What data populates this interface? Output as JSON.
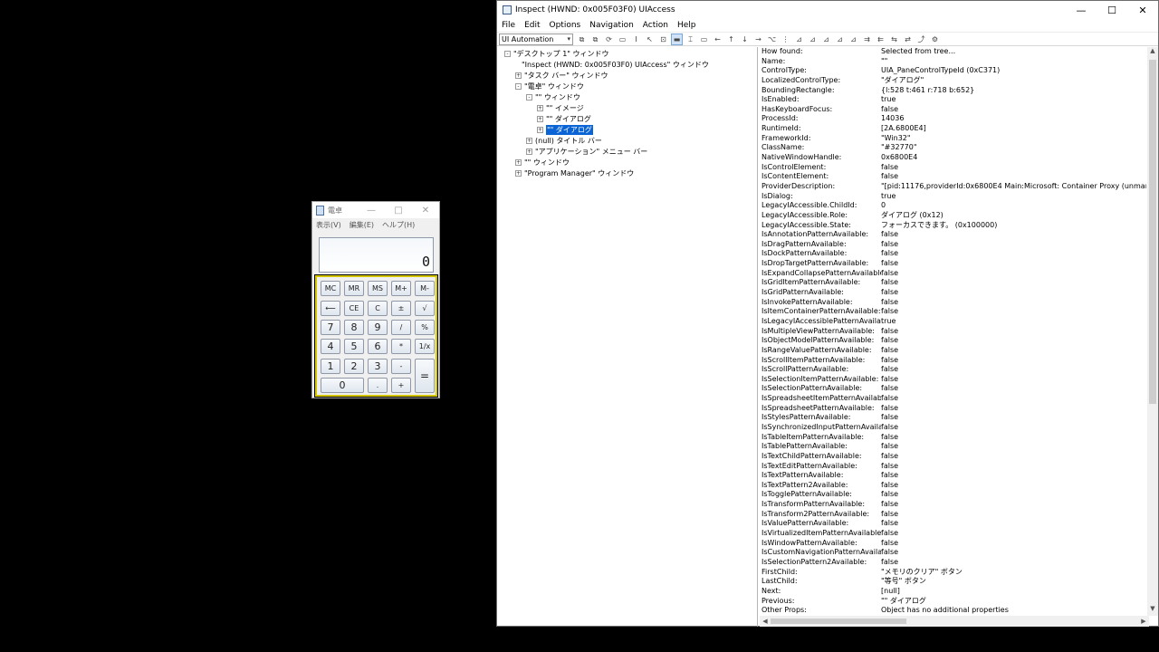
{
  "calculator": {
    "title": "電卓",
    "menu": [
      "表示(V)",
      "編集(E)",
      "ヘルプ(H)"
    ],
    "display": "0",
    "window_buttons": [
      "—",
      "□",
      "✕"
    ],
    "keys": [
      {
        "label": "MC",
        "name": "mc-key"
      },
      {
        "label": "MR",
        "name": "mr-key"
      },
      {
        "label": "MS",
        "name": "ms-key"
      },
      {
        "label": "M+",
        "name": "m-plus-key"
      },
      {
        "label": "M-",
        "name": "m-minus-key"
      },
      {
        "label": "⟵",
        "name": "backspace-key"
      },
      {
        "label": "CE",
        "name": "ce-key"
      },
      {
        "label": "C",
        "name": "c-key"
      },
      {
        "label": "±",
        "name": "plus-minus-key"
      },
      {
        "label": "√",
        "name": "sqrt-key"
      },
      {
        "label": "7",
        "name": "digit-7-key"
      },
      {
        "label": "8",
        "name": "digit-8-key"
      },
      {
        "label": "9",
        "name": "digit-9-key"
      },
      {
        "label": "/",
        "name": "divide-key"
      },
      {
        "label": "%",
        "name": "percent-key"
      },
      {
        "label": "4",
        "name": "digit-4-key"
      },
      {
        "label": "5",
        "name": "digit-5-key"
      },
      {
        "label": "6",
        "name": "digit-6-key"
      },
      {
        "label": "*",
        "name": "multiply-key"
      },
      {
        "label": "1/x",
        "name": "reciprocal-key"
      },
      {
        "label": "1",
        "name": "digit-1-key"
      },
      {
        "label": "2",
        "name": "digit-2-key"
      },
      {
        "label": "3",
        "name": "digit-3-key"
      },
      {
        "label": "-",
        "name": "minus-key"
      },
      {
        "label": "=",
        "name": "equals-key"
      },
      {
        "label": "0",
        "name": "digit-0-key"
      },
      {
        "label": ".",
        "name": "decimal-key"
      },
      {
        "label": "+",
        "name": "plus-key"
      }
    ]
  },
  "inspect": {
    "title": "Inspect  (HWND: 0x005F03F0) UIAccess",
    "window_buttons": [
      "—",
      "☐",
      "✕"
    ],
    "menu": [
      "File",
      "Edit",
      "Options",
      "Navigation",
      "Action",
      "Help"
    ],
    "mode": "UI Automation",
    "tree": [
      {
        "text": "\"デスクトップ 1\" ウィンドウ",
        "state": "-"
      },
      {
        "text": "\"Inspect  (HWND: 0x005F03F0) UIAccess\" ウィンドウ",
        "state": ""
      },
      {
        "text": "\"タスク バー\" ウィンドウ",
        "state": "+"
      },
      {
        "text": "\"電卓\" ウィンドウ",
        "state": "-"
      },
      {
        "text": "\"\" ウィンドウ",
        "state": "-"
      },
      {
        "text": "\"\" イメージ",
        "state": "+"
      },
      {
        "text": "\"\" ダイアログ",
        "state": "+"
      },
      {
        "text": "\"\" ダイアログ",
        "state": "+",
        "selected": true
      },
      {
        "text": "(null) タイトル バー",
        "state": "+"
      },
      {
        "text": "\"アプリケーション\" メニュー バー",
        "state": "+"
      },
      {
        "text": "\"\" ウィンドウ",
        "state": "+"
      },
      {
        "text": "\"Program Manager\" ウィンドウ",
        "state": "+"
      }
    ],
    "properties": [
      [
        "How found:",
        "Selected from tree..."
      ],
      [
        "Name:",
        "\"\""
      ],
      [
        "ControlType:",
        "UIA_PaneControlTypeId (0xC371)"
      ],
      [
        "LocalizedControlType:",
        "\"ダイアログ\""
      ],
      [
        "BoundingRectangle:",
        "{l:528 t:461 r:718 b:652}"
      ],
      [
        "IsEnabled:",
        "true"
      ],
      [
        "HasKeyboardFocus:",
        "false"
      ],
      [
        "ProcessId:",
        "14036"
      ],
      [
        "RuntimeId:",
        "[2A.6800E4]"
      ],
      [
        "FrameworkId:",
        "\"Win32\""
      ],
      [
        "ClassName:",
        "\"#32770\""
      ],
      [
        "NativeWindowHandle:",
        "0x6800E4"
      ],
      [
        "IsControlElement:",
        "false"
      ],
      [
        "IsContentElement:",
        "false"
      ],
      [
        "ProviderDescription:",
        "\"[pid:11176,providerId:0x6800E4 Main:Microsoft: Container Proxy (unmanaged:uiautoma"
      ],
      [
        "IsDialog:",
        "true"
      ],
      [
        "LegacyIAccessible.ChildId:",
        "0"
      ],
      [
        "LegacyIAccessible.Role:",
        "ダイアログ (0x12)"
      ],
      [
        "LegacyIAccessible.State:",
        "フォーカスできます。 (0x100000)"
      ],
      [
        "IsAnnotationPatternAvailable:",
        "false"
      ],
      [
        "IsDragPatternAvailable:",
        "false"
      ],
      [
        "IsDockPatternAvailable:",
        "false"
      ],
      [
        "IsDropTargetPatternAvailable:",
        "false"
      ],
      [
        "IsExpandCollapsePatternAvailable:",
        "false"
      ],
      [
        "IsGridItemPatternAvailable:",
        "false"
      ],
      [
        "IsGridPatternAvailable:",
        "false"
      ],
      [
        "IsInvokePatternAvailable:",
        "false"
      ],
      [
        "IsItemContainerPatternAvailable:",
        "false"
      ],
      [
        "IsLegacyIAccessiblePatternAvailable:",
        "true"
      ],
      [
        "IsMultipleViewPatternAvailable:",
        "false"
      ],
      [
        "IsObjectModelPatternAvailable:",
        "false"
      ],
      [
        "IsRangeValuePatternAvailable:",
        "false"
      ],
      [
        "IsScrollItemPatternAvailable:",
        "false"
      ],
      [
        "IsScrollPatternAvailable:",
        "false"
      ],
      [
        "IsSelectionItemPatternAvailable:",
        "false"
      ],
      [
        "IsSelectionPatternAvailable:",
        "false"
      ],
      [
        "IsSpreadsheetItemPatternAvailable:",
        "false"
      ],
      [
        "IsSpreadsheetPatternAvailable:",
        "false"
      ],
      [
        "IsStylesPatternAvailable:",
        "false"
      ],
      [
        "IsSynchronizedInputPatternAvailable:",
        "false"
      ],
      [
        "IsTableItemPatternAvailable:",
        "false"
      ],
      [
        "IsTablePatternAvailable:",
        "false"
      ],
      [
        "IsTextChildPatternAvailable:",
        "false"
      ],
      [
        "IsTextEditPatternAvailable:",
        "false"
      ],
      [
        "IsTextPatternAvailable:",
        "false"
      ],
      [
        "IsTextPattern2Available:",
        "false"
      ],
      [
        "IsTogglePatternAvailable:",
        "false"
      ],
      [
        "IsTransformPatternAvailable:",
        "false"
      ],
      [
        "IsTransform2PatternAvailable:",
        "false"
      ],
      [
        "IsValuePatternAvailable:",
        "false"
      ],
      [
        "IsVirtualizedItemPatternAvailable:",
        "false"
      ],
      [
        "IsWindowPatternAvailable:",
        "false"
      ],
      [
        "IsCustomNavigationPatternAvailable:",
        "false"
      ],
      [
        "IsSelectionPattern2Available:",
        "false"
      ],
      [
        "FirstChild:",
        "\"メモリのクリア\" ボタン"
      ],
      [
        "LastChild:",
        "\"等号\" ボタン"
      ],
      [
        "Next:",
        "[null]"
      ],
      [
        "Previous:",
        "\"\" ダイアログ"
      ],
      [
        "Other Props:",
        "Object has no additional properties"
      ]
    ]
  }
}
